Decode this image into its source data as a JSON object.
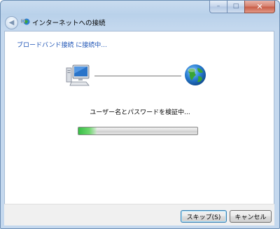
{
  "window": {
    "title": "インターネットへの接続",
    "caption_buttons": {
      "minimize": "–",
      "maximize": "□",
      "close": "✕"
    },
    "back_icon": "back-arrow-icon",
    "title_icon": "network-connection-icon"
  },
  "main": {
    "instruction": "ブロードバンド接続 に接続中...",
    "computer_icon": "computer-icon",
    "globe_icon": "globe-icon",
    "status": "ユーザー名とパスワードを検証中...",
    "progress_fraction": 0.15
  },
  "footer": {
    "skip_label": "スキップ(S)",
    "cancel_label": "キャンセル"
  },
  "colors": {
    "instruction_text": "#1c52b4",
    "frame": "#c4d8ee",
    "progress": "#37be46"
  }
}
